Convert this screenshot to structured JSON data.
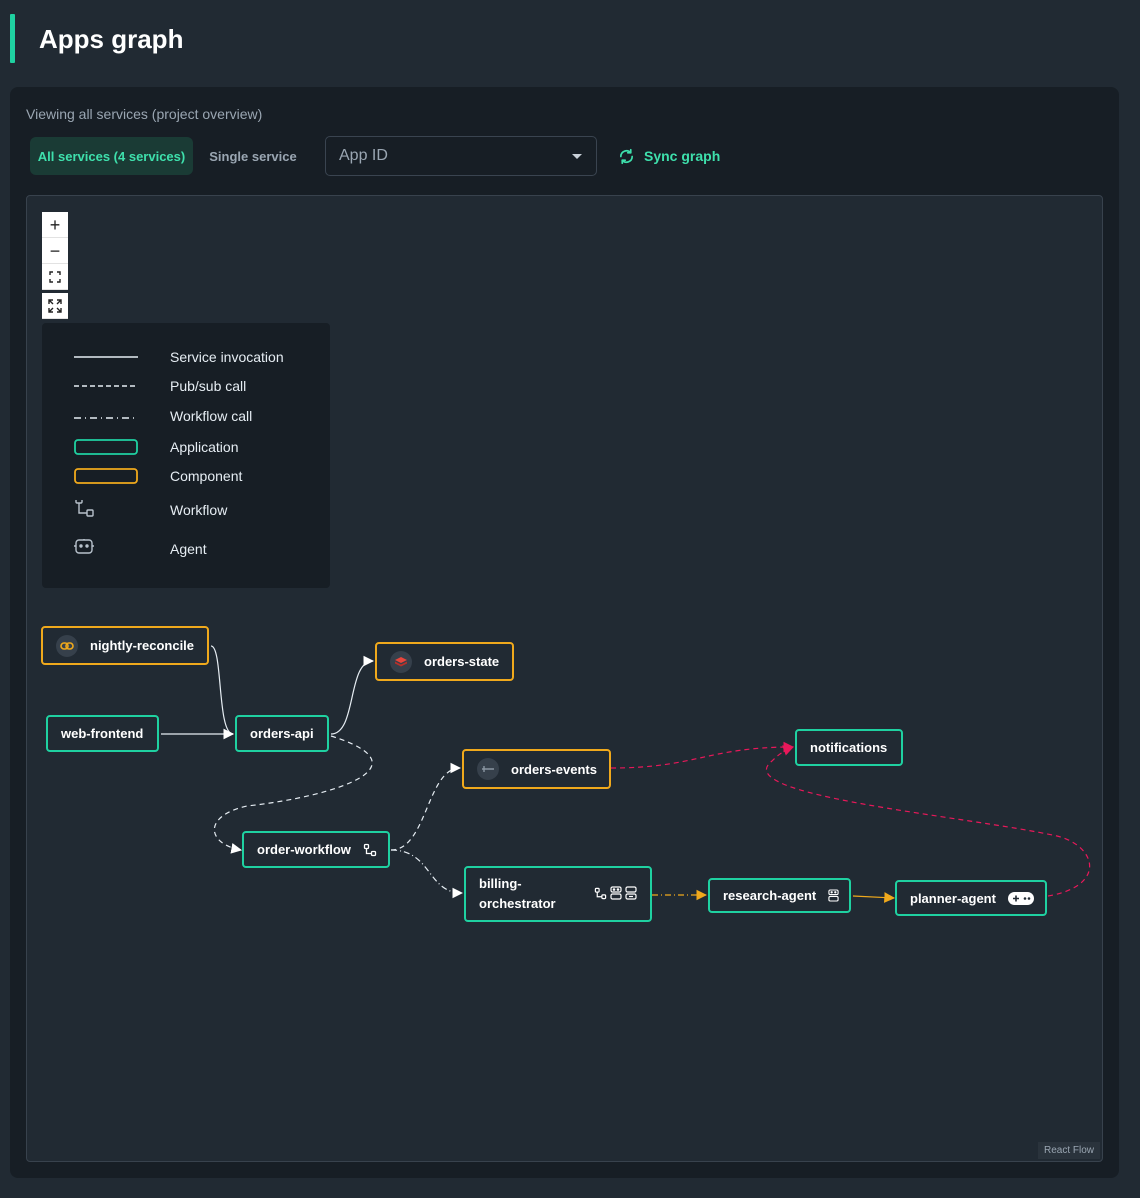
{
  "page": {
    "title": "Apps graph"
  },
  "toolbar": {
    "subtitle": "Viewing all services (project overview)",
    "tab_all": "All services (4 services)",
    "tab_single": "Single service",
    "app_id_placeholder": "App ID",
    "sync_label": "Sync graph"
  },
  "controls": {
    "zoom_in": "+",
    "zoom_out": "−"
  },
  "legend": {
    "service_invocation": "Service invocation",
    "pubsub_call": "Pub/sub call",
    "workflow_call": "Workflow call",
    "application": "Application",
    "component": "Component",
    "workflow": "Workflow",
    "agent": "Agent"
  },
  "nodes": {
    "nightly_reconcile": "nightly-reconcile",
    "orders_state": "orders-state",
    "web_frontend": "web-frontend",
    "orders_api": "orders-api",
    "orders_events": "orders-events",
    "notifications": "notifications",
    "order_workflow": "order-workflow",
    "billing_orchestrator_1": "billing-",
    "billing_orchestrator_2": "orchestrator",
    "research_agent": "research-agent",
    "planner_agent": "planner-agent"
  },
  "colors": {
    "accent": "#1fd1a1",
    "component": "#f0a91c",
    "pubsub_edge": "#e8185a",
    "agent_edge": "#f0a91c",
    "edge": "#e6edf3"
  },
  "attribution": "React Flow"
}
